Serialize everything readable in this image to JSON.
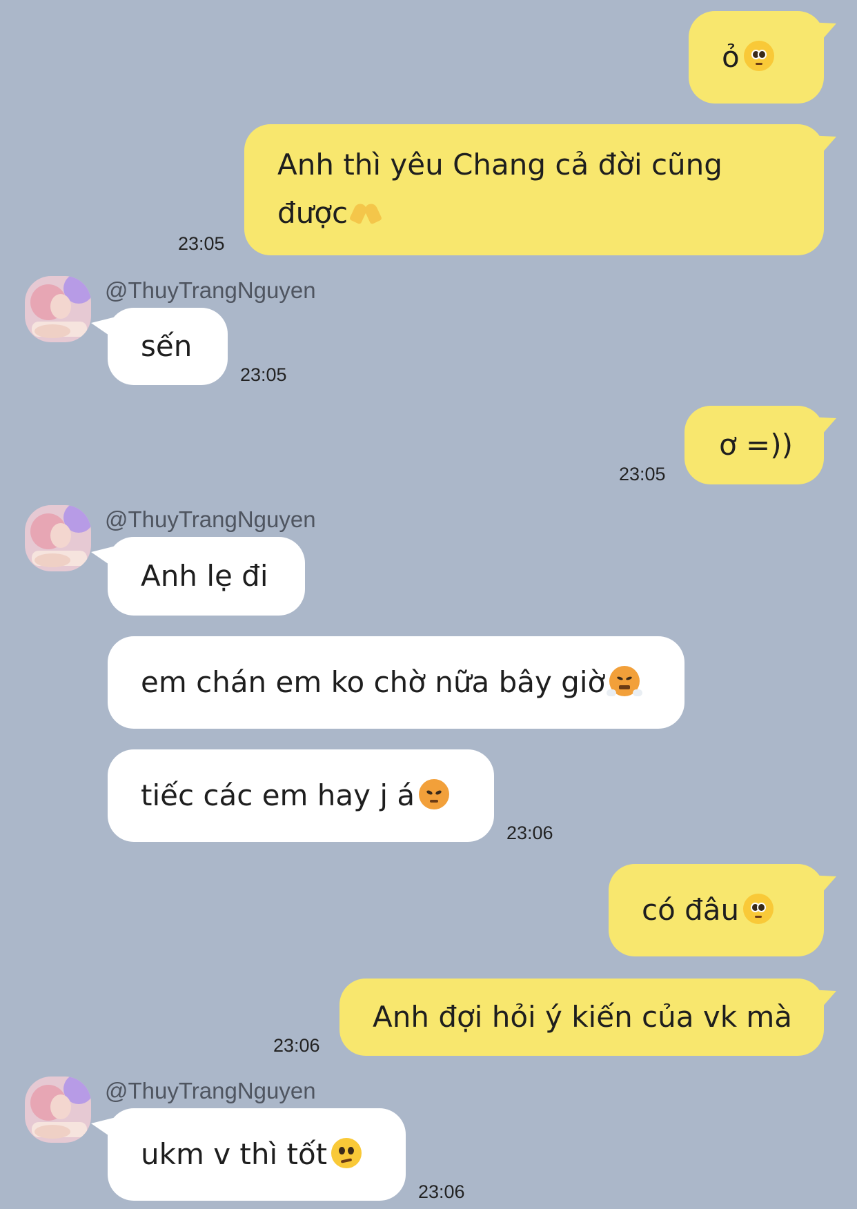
{
  "contact": {
    "handle": "@ThuyTrangNguyen"
  },
  "messages": [
    {
      "id": "m1",
      "direction": "outgoing",
      "text": "ỏ",
      "emoji": "pleading-face-icon",
      "time": ""
    },
    {
      "id": "m2",
      "direction": "outgoing",
      "line1": "Anh thì yêu Chang cả đời cũng",
      "line2": "được",
      "emoji": "heart-hands-icon",
      "time": "23:05"
    },
    {
      "id": "m3",
      "direction": "incoming",
      "sender": "@ThuyTrangNguyen",
      "text": "sến",
      "time": "23:05"
    },
    {
      "id": "m4",
      "direction": "outgoing",
      "text": "ơ =))",
      "time": "23:05"
    },
    {
      "id": "m5",
      "direction": "incoming",
      "sender": "@ThuyTrangNguyen",
      "text": "Anh lẹ đi",
      "time": ""
    },
    {
      "id": "m6",
      "direction": "incoming",
      "text": "em chán em ko chờ nữa bây giờ",
      "emoji": "face-with-steam-icon",
      "time": ""
    },
    {
      "id": "m7",
      "direction": "incoming",
      "text": "tiếc các em hay j á",
      "emoji": "angry-face-icon",
      "time": "23:06"
    },
    {
      "id": "m8",
      "direction": "outgoing",
      "text": "có đâu",
      "emoji": "pleading-face-icon",
      "time": ""
    },
    {
      "id": "m9",
      "direction": "outgoing",
      "text": "Anh đợi hỏi ý kiến của vk mà",
      "time": "23:06"
    },
    {
      "id": "m10",
      "direction": "incoming",
      "sender": "@ThuyTrangNguyen",
      "text": "ukm v thì tốt",
      "emoji": "confused-face-icon",
      "time": "23:06"
    }
  ],
  "colors": {
    "background": "#abb7c9",
    "outgoing_bubble": "#f8e76e",
    "incoming_bubble": "#ffffff"
  }
}
